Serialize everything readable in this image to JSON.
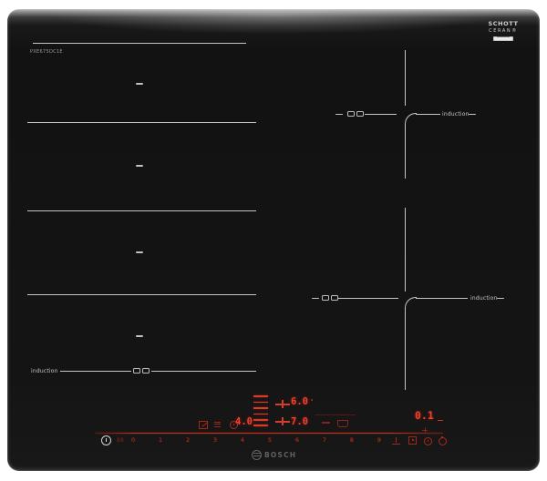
{
  "device": {
    "brand": "BOSCH",
    "model_label": "PXE675DC1E",
    "schott": {
      "line1": "SCHOTT",
      "line2": "CERAN®"
    }
  },
  "zones": {
    "flex_left": {
      "induction_label": "induction"
    },
    "right_top": {
      "induction_label": "induction"
    },
    "right_bottom": {
      "induction_label": "induction"
    }
  },
  "panel": {
    "displays": {
      "timer": "4.0",
      "rear_level": "6.0",
      "front_level": "7.0",
      "right": "0.1"
    },
    "zone_indicator": "88",
    "slider_numbers": [
      "0",
      "1",
      "2",
      "3",
      "4",
      "5",
      "6",
      "7",
      "8",
      "9"
    ],
    "colors": {
      "display_red": "#f2402b",
      "line_red": "#c33422",
      "dim_red": "#8a2419",
      "zone_line_white": "#d6d6d6",
      "glass_black": "#141414"
    },
    "icons": {
      "power-icon": "circle with I (main on/off)",
      "zone-select-indicator": "dim 88 digits",
      "cleaning-wiper-icon": "square with diagonal",
      "menu-icon": "three lines",
      "timer-clock-small-icon": "small clock circle",
      "move-level-ladder": "stack of 6 red rungs",
      "pan-position-cross": "plus marker",
      "pan-icon": "small pan outline",
      "keep-warm-icon": "stem on base line",
      "lock-icon": "square with dot",
      "clock-icon": "clock circle",
      "kitchen-timer-icon": "clock circle with stem",
      "flex-bridge-icon": "two bridged cookware rectangles",
      "bosch-anchor-icon": "circle with armature bars"
    }
  }
}
